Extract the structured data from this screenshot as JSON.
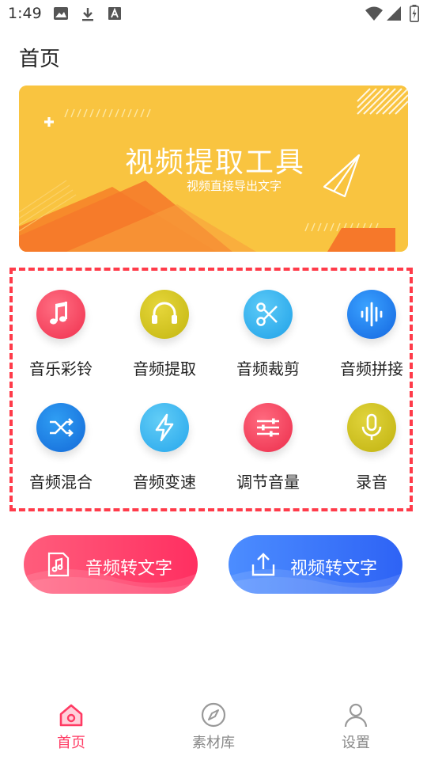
{
  "status_bar": {
    "time": "1:49"
  },
  "header": {
    "title": "首页"
  },
  "banner": {
    "title": "视频提取工具",
    "subtitle": "视频直接导出文字"
  },
  "tools": [
    {
      "label": "音乐彩铃",
      "icon": "music-note-icon"
    },
    {
      "label": "音频提取",
      "icon": "headphones-icon"
    },
    {
      "label": "音频裁剪",
      "icon": "scissors-icon"
    },
    {
      "label": "音频拼接",
      "icon": "waveform-icon"
    },
    {
      "label": "音频混合",
      "icon": "shuffle-icon"
    },
    {
      "label": "音频变速",
      "icon": "lightning-icon"
    },
    {
      "label": "调节音量",
      "icon": "sliders-icon"
    },
    {
      "label": "录音",
      "icon": "microphone-icon"
    }
  ],
  "actions": {
    "audio_to_text": "音频转文字",
    "video_to_text": "视频转文字"
  },
  "bottom_nav": {
    "home": "首页",
    "material": "素材库",
    "settings": "设置"
  },
  "colors": {
    "accent_pink": "#ff3a63",
    "banner_yellow": "#f9c440",
    "banner_orange": "#f6782a",
    "dashed_border": "#ff3b4a"
  }
}
